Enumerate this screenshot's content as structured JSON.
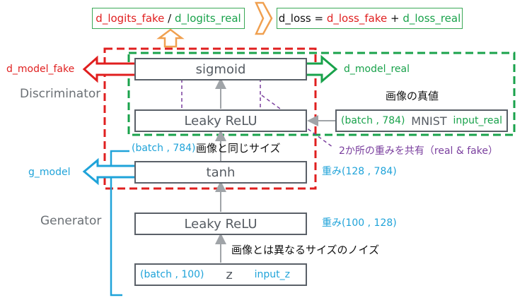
{
  "top": {
    "logits": {
      "fake": "d_logits_fake",
      "sep": " / ",
      "real": "d_logits_real"
    },
    "loss": {
      "lhs": "d_loss",
      "eq": " = ",
      "fake": "d_loss_fake",
      "plus": " + ",
      "real": "d_loss_real"
    }
  },
  "labels": {
    "discriminator": "Discriminator",
    "generator": "Generator",
    "d_model_fake": "d_model_fake",
    "d_model_real": "d_model_real",
    "g_model": "g_model",
    "real_image": "画像の真値",
    "batch_784_gen": "(batch , 784)",
    "same_size": "画像と同じサイズ",
    "share_weights": "2か所の重みを共有（real & fake）",
    "weights_128_784": "重み(128 , 784)",
    "weights_100_128": "重み(100 , 128)",
    "noise": "画像とは異なるサイズのノイズ"
  },
  "layers": {
    "sigmoid": "sigmoid",
    "leaky_relu_d": "Leaky ReLU",
    "tanh": "tanh",
    "leaky_relu_g": "Leaky ReLU",
    "z": "z",
    "z_batch": "(batch , 100)",
    "z_input": "input_z"
  },
  "mnist": {
    "batch": "(batch , 784)",
    "name": "MNIST",
    "input": "input_real"
  },
  "colors": {
    "red": "#e01f1f",
    "green": "#19a24b",
    "blue": "#1fa3d9",
    "orange": "#f0a050",
    "purple": "#7a3f9e",
    "box_border": "#5a6068"
  }
}
